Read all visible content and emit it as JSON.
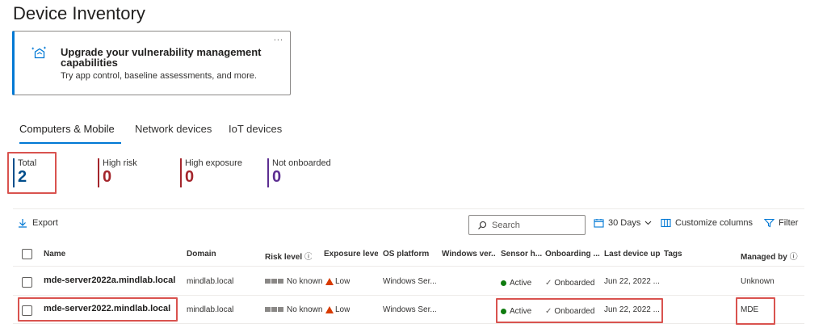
{
  "page": {
    "title": "Device Inventory"
  },
  "promo": {
    "title": "Upgrade your vulnerability management capabilities",
    "subtitle": "Try app control, baseline assessments, and more.",
    "more": "..."
  },
  "tabs": [
    {
      "label": "Computers & Mobile",
      "active": true
    },
    {
      "label": "Network devices",
      "active": false
    },
    {
      "label": "IoT devices",
      "active": false
    }
  ],
  "stats": [
    {
      "label": "Total",
      "value": "2",
      "color": "#004e8c"
    },
    {
      "label": "High risk",
      "value": "0",
      "color": "#a4262c"
    },
    {
      "label": "High exposure",
      "value": "0",
      "color": "#a4262c"
    },
    {
      "label": "Not onboarded",
      "value": "0",
      "color": "#5c2e91"
    }
  ],
  "toolbar": {
    "export": "Export",
    "search_placeholder": "Search",
    "days": "30 Days",
    "customize": "Customize columns",
    "filter": "Filter"
  },
  "columns": {
    "name": "Name",
    "domain": "Domain",
    "risk": "Risk level",
    "exposure": "Exposure level",
    "os": "OS platform",
    "winver": "Windows ver...",
    "sensor": "Sensor h...",
    "onboarding": "Onboarding ...",
    "lastupdate": "Last device upc",
    "tags": "Tags",
    "managed": "Managed by"
  },
  "rows": [
    {
      "name": "mde-server2022a.mindlab.local",
      "domain": "mindlab.local",
      "risk": "No known",
      "exposure": "Low",
      "os": "Windows Ser...",
      "winver": "",
      "sensor": "Active",
      "onboarding": "Onboarded",
      "lastupdate": "Jun 22, 2022 ...",
      "tags": "",
      "managed": "Unknown"
    },
    {
      "name": "mde-server2022.mindlab.local",
      "domain": "mindlab.local",
      "risk": "No known",
      "exposure": "Low",
      "os": "Windows Ser...",
      "winver": "",
      "sensor": "Active",
      "onboarding": "Onboarded",
      "lastupdate": "Jun 22, 2022 ...",
      "tags": "",
      "managed": "MDE"
    }
  ],
  "colors": {
    "accent": "#0078d4",
    "highlight": "#d9534f",
    "active": "#107c10",
    "warning": "#d83b01"
  }
}
